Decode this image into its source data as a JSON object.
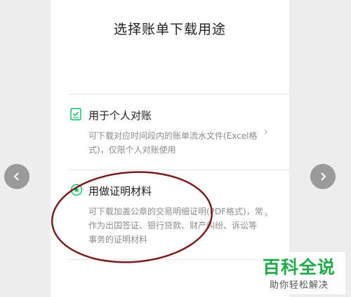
{
  "dialog": {
    "title": "选择账单下载用途"
  },
  "options": [
    {
      "title": "用于个人对账",
      "desc": "可下载对应时间段内的账单流水文件(Excel格式)，仅限个人对账使用",
      "icon": "checklist-icon"
    },
    {
      "title": "用做证明材料",
      "desc": "可下载加盖公章的交易明细证明(PDF格式)，常作为出国签证、银行贷款、财产纠纷、诉讼等事务的证明材料",
      "icon": "seal-icon"
    }
  ],
  "icons": {
    "chevron": "›",
    "prev": "‹",
    "next": "›"
  },
  "colors": {
    "accent": "#07c160",
    "annotation": "#7a1c1c",
    "watermark": "#22a94a"
  },
  "watermark": {
    "title": "百科全说",
    "subtitle": "助你轻松解决"
  }
}
